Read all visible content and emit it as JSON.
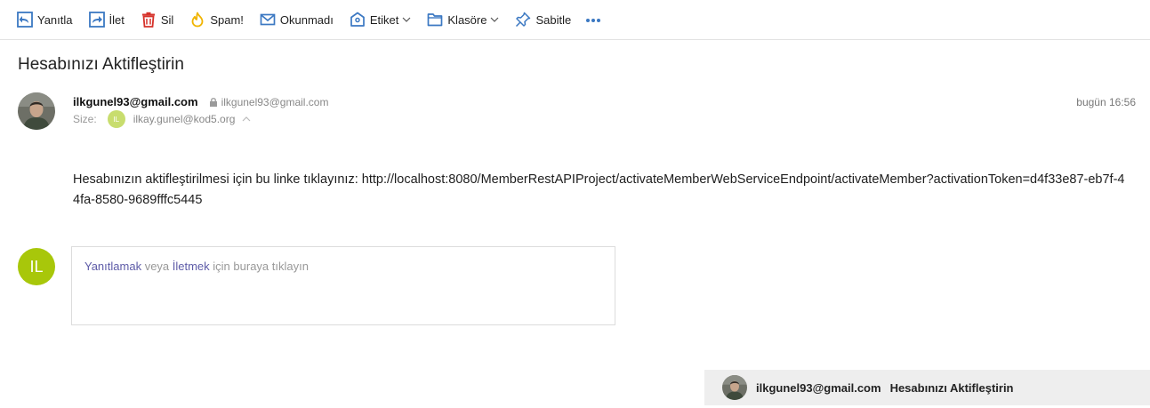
{
  "toolbar": {
    "reply_label": "Yanıtla",
    "forward_label": "İlet",
    "delete_label": "Sil",
    "spam_label": "Spam!",
    "unread_label": "Okunmadı",
    "label_label": "Etiket",
    "folder_label": "Klasöre",
    "pin_label": "Sabitle",
    "more_label": "•••"
  },
  "email": {
    "subject": "Hesabınızı Aktifleştirin",
    "from_name": "ilkgunel93@gmail.com",
    "from_address": "ilkgunel93@gmail.com",
    "date": "bugün 16:56",
    "to_label": "Size:",
    "to_initials": "IL",
    "to_address": "ilkay.gunel@kod5.org",
    "body": "Hesabınızın aktifleştirilmesi için bu linke tıklayınız: http://localhost:8080/MemberRestAPIProject/activateMemberWebServiceEndpoint/activateMember?activationToken=d4f33e87-eb7f-44fa-8580-9689fffc5445"
  },
  "reply": {
    "avatar_initials": "IL",
    "reply_link": "Yanıtlamak",
    "or_text": " veya ",
    "forward_link": "İletmek",
    "suffix": " için buraya tıklayın"
  },
  "bottom_bar": {
    "sender": "ilkgunel93@gmail.com",
    "subject": "Hesabınızı Aktifleştirin"
  },
  "colors": {
    "accent_blue": "#3b78c2",
    "delete_red": "#d6322a",
    "spam_yellow": "#f0b400",
    "avatar_green": "#a8c70a",
    "link_purple": "#5e5ca8"
  },
  "icons": {
    "reply": "reply-icon",
    "forward": "forward-icon",
    "delete": "trash-icon",
    "spam": "flame-icon",
    "unread": "envelope-icon",
    "label": "tag-icon",
    "folder": "folder-icon",
    "pin": "pin-icon",
    "more": "more-dots-icon",
    "lock": "lock-icon"
  }
}
